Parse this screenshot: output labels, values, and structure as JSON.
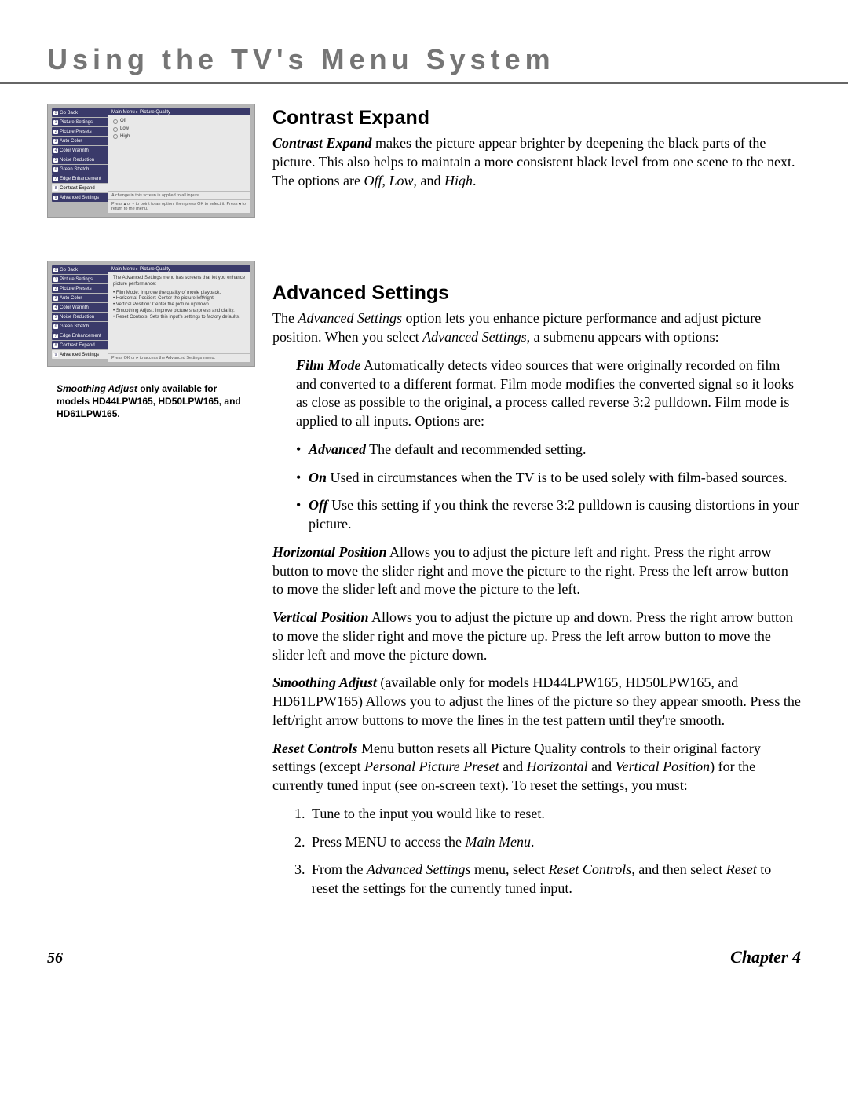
{
  "header": {
    "title": "Using the TV's Menu System"
  },
  "menu1": {
    "crumb": "Main Menu ▸ Picture Quality",
    "items": [
      "Go Back",
      "Picture Settings",
      "Picture Presets",
      "Auto Color",
      "Color Warmth",
      "Noise Reduction",
      "Green Stretch",
      "Edge Enhancement",
      "Contrast Expand",
      "Advanced Settings"
    ],
    "selectedIndex": 8,
    "options": [
      "Off",
      "Low",
      "High"
    ],
    "hint1": "A change in this screen is applied to all inputs.",
    "hint2": "Press ▴ or ▾ to point to an option, then press OK to select it. Press ◂ to return to the menu."
  },
  "menu2": {
    "crumb": "Main Menu ▸ Picture Quality",
    "items": [
      "Go Back",
      "Picture Settings",
      "Picture Presets",
      "Auto Color",
      "Color Warmth",
      "Noise Reduction",
      "Green Stretch",
      "Edge Enhancement",
      "Contrast Expand",
      "Advanced Settings"
    ],
    "selectedIndex": 9,
    "intro": "The Advanced Settings menu has screens that let you enhance picture performance:",
    "bullets": [
      "Film Mode: Improve the quality of movie playback.",
      "Horizontal Position: Center the picture left/right.",
      "Vertical Position: Center the picture up/down.",
      "Smoothing Adjust: Improve picture sharpness and clarity.",
      "Reset Controls: Sets this input's settings to factory defaults."
    ],
    "hint": "Press OK or ▸ to access the Advanced Settings menu."
  },
  "note": {
    "lead": "Smoothing Adjust",
    "rest": " only available for models HD44LPW165, HD50LPW165, and HD61LPW165."
  },
  "section1": {
    "title": "Contrast Expand",
    "p1a": "Contrast Expand",
    "p1b": " makes the picture appear brighter by deepening the black parts of the picture. This also helps to maintain a more consistent black level from one scene to the next. The options are ",
    "p1c": "Off",
    "p1d": ", ",
    "p1e": "Low",
    "p1f": ", and ",
    "p1g": "High",
    "p1h": "."
  },
  "section2": {
    "title": "Advanced Settings",
    "p1a": "The ",
    "p1b": "Advanced Settings",
    "p1c": " option lets you enhance picture performance and adjust picture position. When you select ",
    "p1d": "Advanced Settings",
    "p1e": ", a submenu appears with options:",
    "film": {
      "label": "Film Mode",
      "body": "   Automatically detects video sources that were originally recorded on film and converted to a different format. Film mode modifies the converted signal so it looks as close as possible to the original, a process called reverse 3:2 pulldown. Film mode is applied to all inputs. Options are:"
    },
    "bul_adv_l": "Advanced",
    "bul_adv_b": "   The default and recommended setting.",
    "bul_on_l": "On",
    "bul_on_b": "   Used in circumstances when the TV is to be used solely with film-based sources.",
    "bul_off_l": "Off",
    "bul_off_b": "   Use this setting if you think the reverse 3:2 pulldown is causing distortions in your picture.",
    "hpos_l": "Horizontal Position",
    "hpos_b": "   Allows you to adjust the picture left and right. Press the right arrow button to move the slider right and move the picture to the right. Press the left arrow button to move the slider left and move the picture to the left.",
    "vpos_l": "Vertical Position",
    "vpos_b": "   Allows you to adjust the picture up and down. Press the right arrow button to move the slider right and move the picture up. Press the left arrow button to move the slider left and move the picture down.",
    "smth_l": "Smoothing Adjust",
    "smth_b": " (available only for models HD44LPW165, HD50LPW165, and HD61LPW165)   Allows you to adjust the lines of the picture so they appear smooth. Press the left/right arrow buttons to move the lines in the test pattern until they're smooth.",
    "rst_l": "Reset Controls",
    "rst_b1": "   Menu button resets all Picture Quality controls to their original factory settings (except ",
    "rst_b2": "Personal Picture Preset",
    "rst_b3": " and ",
    "rst_b4": "Horizontal",
    "rst_b5": " and ",
    "rst_b6": "Vertical Position",
    "rst_b7": ") for the currently tuned input (see on-screen text). To reset the settings, you must:",
    "step1": "Tune to the input you would like to reset.",
    "step2a": "Press MENU to access the ",
    "step2b": "Main Menu",
    "step2c": ".",
    "step3a": "From the ",
    "step3b": "Advanced Settings",
    "step3c": " menu, select ",
    "step3d": "Reset Controls,",
    "step3e": " and then select ",
    "step3f": "Reset",
    "step3g": " to reset the settings for the currently tuned input."
  },
  "footer": {
    "page": "56",
    "chapter": "Chapter 4"
  }
}
